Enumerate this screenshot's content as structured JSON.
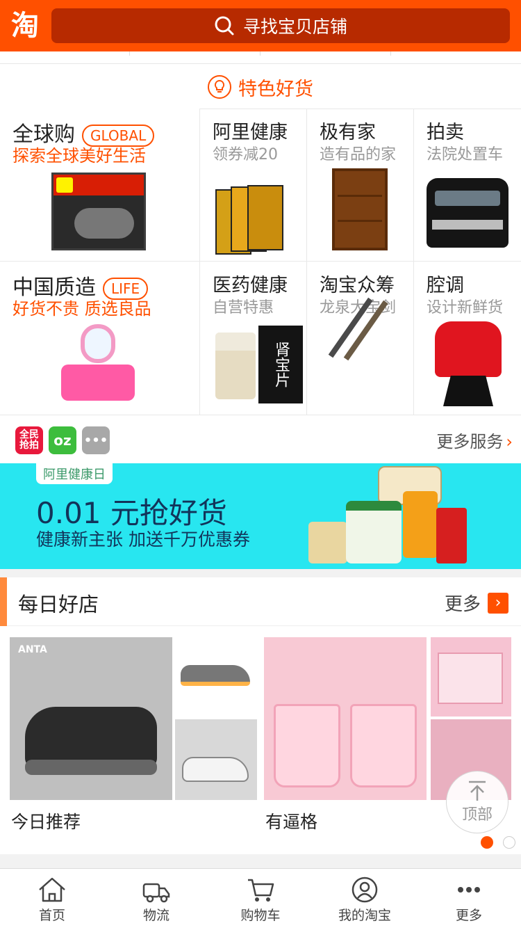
{
  "header": {
    "logo": "淘",
    "search_placeholder": "寻找宝贝店铺"
  },
  "featured": {
    "title": "特色好货",
    "cells": [
      {
        "title": "全球购",
        "tag": "GLOBAL",
        "subtitle": "探索全球美好生活"
      },
      {
        "title": "阿里健康",
        "subtitle": "领券减20"
      },
      {
        "title": "极有家",
        "subtitle": "造有品的家"
      },
      {
        "title": "拍卖",
        "subtitle": "法院处置车"
      },
      {
        "title": "中国质造",
        "tag": "LIFE",
        "subtitle": "好货不贵 质选良品"
      },
      {
        "title": "医药健康",
        "subtitle": "自营特惠"
      },
      {
        "title": "淘宝众筹",
        "subtitle": "龙泉大宝剑"
      },
      {
        "title": "腔调",
        "subtitle": "设计新鲜货"
      }
    ],
    "pill_box_text": "肾宝片"
  },
  "services": {
    "icons": [
      {
        "label": "全民抢拍",
        "color": "#e8193c"
      },
      {
        "label": "oz",
        "color": "#3dbd3d"
      },
      {
        "label": "•••",
        "color": "#a8a8a8"
      }
    ],
    "more_label": "更多服务",
    "more_arrow": "›"
  },
  "banner": {
    "badge": "阿里健康日",
    "headline": "0.01 元抢好货",
    "subline": "健康新主张  加送千万优惠券"
  },
  "shops": {
    "title": "每日好店",
    "more_label": "更多",
    "more_arrow": "›",
    "brand_mark": "ANTA",
    "items": [
      {
        "label": "今日推荐"
      },
      {
        "label": "有逼格"
      }
    ],
    "pager": {
      "current": 1,
      "total": 2
    }
  },
  "back_to_top": "顶部",
  "nav": [
    {
      "label": "首页",
      "icon": "home-icon"
    },
    {
      "label": "物流",
      "icon": "truck-icon"
    },
    {
      "label": "购物车",
      "icon": "cart-icon"
    },
    {
      "label": "我的淘宝",
      "icon": "user-icon"
    },
    {
      "label": "更多",
      "icon": "more-dots-icon"
    }
  ],
  "colors": {
    "brand": "#ff5000",
    "search_bg": "#b72a00",
    "banner_bg": "#28e6f0"
  }
}
